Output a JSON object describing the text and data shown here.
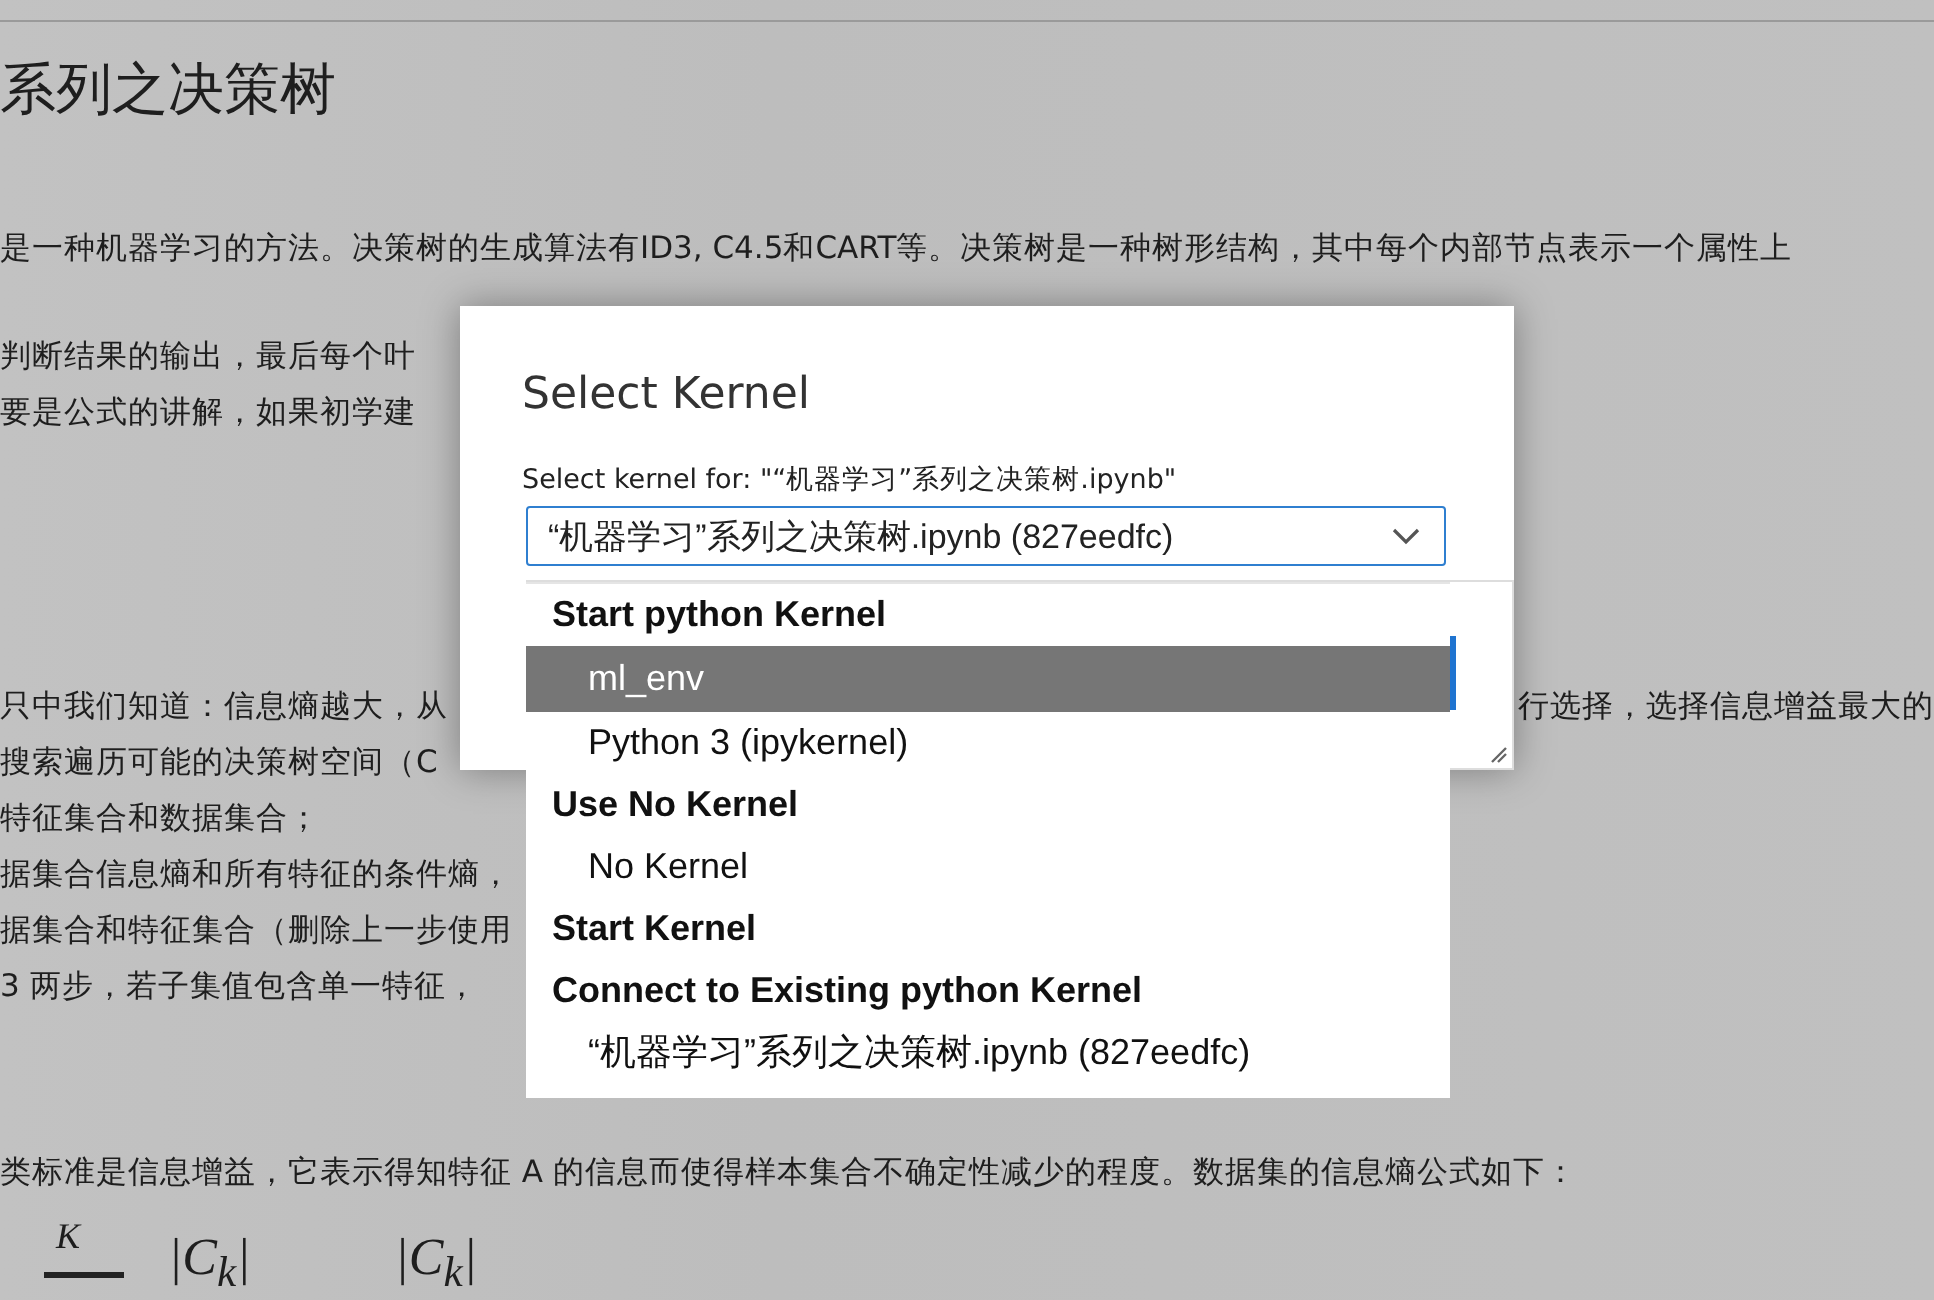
{
  "document": {
    "title": "系列之决策树",
    "paragraphs": [
      {
        "lines": [
          "是一种机器学习的方法。决策树的生成算法有ID3, C4.5和CART等。决策树是一种树形结构，其中每个内部节点表示一个属性上"
        ]
      },
      {
        "lines": [
          "判断结果的输出，最后每个叶",
          "要是公式的讲解，如果初学建"
        ]
      },
      {
        "lines": [
          {
            "left": "只中我们知道：信息熵越大，从",
            "right": "行选择，选择信息增益最大的"
          },
          "搜索遍历可能的决策树空间（C",
          "特征集合和数据集合；",
          "据集合信息熵和所有特征的条件熵，",
          "据集合和特征集合（删除上一步使用",
          "3 两步，若子集值包含单一特征，"
        ]
      },
      {
        "lines": [
          "类标准是信息增益，它表示得知特征 A 的信息而使得样本集合不确定性减少的程度。数据集的信息熵公式如下："
        ]
      }
    ],
    "formula": {
      "upper": "K",
      "terms": [
        "|C$_{k}$|",
        "|C$_{k}$|"
      ]
    }
  },
  "dialog": {
    "title": "Select Kernel",
    "label": "Select kernel for: \"“机器学习”系列之决策树.ipynb\"",
    "select": {
      "value": "“机器学习”系列之决策树.ipynb (827eedfc)"
    },
    "options": [
      {
        "kind": "heading",
        "label": "Start python Kernel"
      },
      {
        "kind": "option",
        "label": "ml_env",
        "selected": true
      },
      {
        "kind": "option",
        "label": "Python 3 (ipykernel)",
        "selected": false
      },
      {
        "kind": "heading",
        "label": "Use No Kernel"
      },
      {
        "kind": "option",
        "label": "No Kernel",
        "selected": false
      },
      {
        "kind": "heading",
        "label": "Start Kernel"
      },
      {
        "kind": "heading",
        "label": "Connect to Existing python Kernel"
      },
      {
        "kind": "option",
        "label": "“机器学习”系列之决策树.ipynb (827eedfc)",
        "selected": false
      }
    ]
  }
}
